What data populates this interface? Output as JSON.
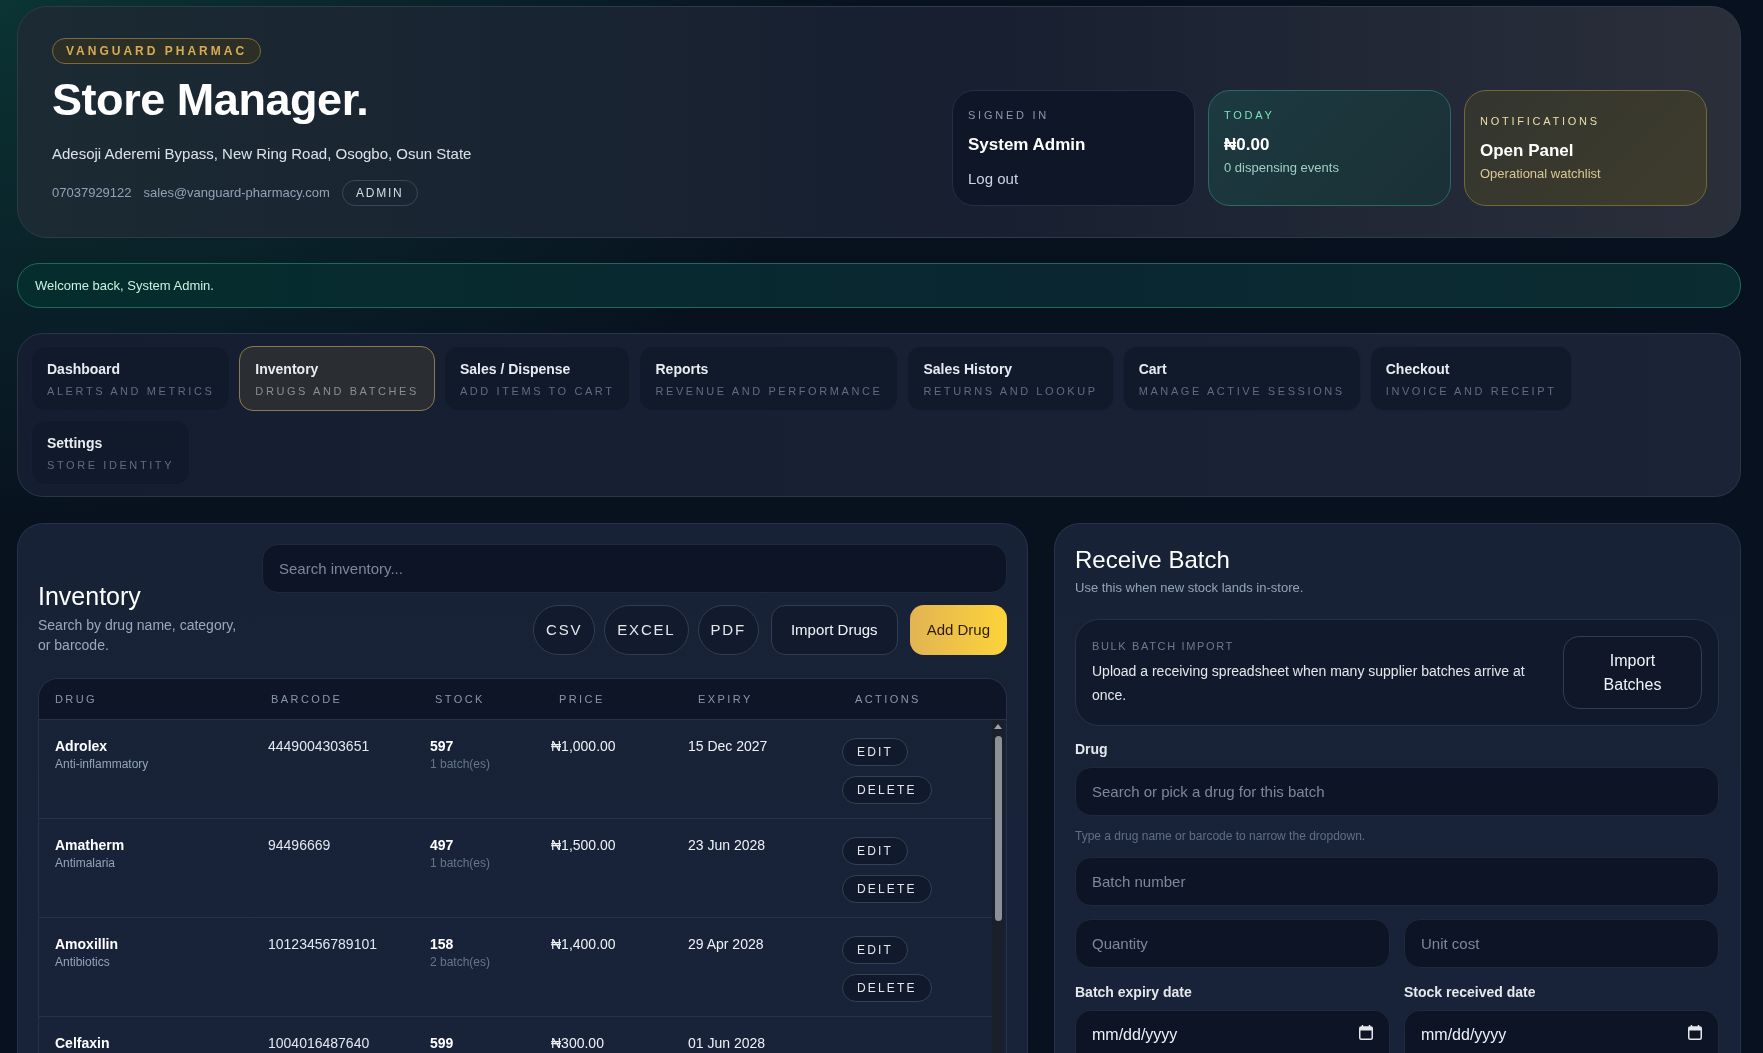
{
  "header": {
    "brand": "VANGUARD PHARMAC",
    "title": "Store Manager.",
    "address": "Adesoji Aderemi Bypass, New Ring Road, Osogbo, Osun State",
    "phone": "07037929122",
    "email": "sales@vanguard-pharmacy.com",
    "role": "ADMIN",
    "cards": [
      {
        "kind": "account",
        "label": "SIGNED IN",
        "title": "System Admin",
        "action": "Log out"
      },
      {
        "kind": "today",
        "label": "TODAY",
        "title": "₦0.00",
        "subtitle": "0 dispensing events"
      },
      {
        "kind": "notifications",
        "label": "NOTIFICATIONS",
        "title": "Open Panel",
        "subtitle": "Operational watchlist"
      }
    ]
  },
  "banner": {
    "message": "Welcome back, System Admin."
  },
  "nav": {
    "tabs": [
      {
        "label": "Dashboard",
        "caption": "ALERTS AND METRICS",
        "selected": false
      },
      {
        "label": "Inventory",
        "caption": "DRUGS AND BATCHES",
        "selected": true
      },
      {
        "label": "Sales / Dispense",
        "caption": "ADD ITEMS TO CART",
        "selected": false
      },
      {
        "label": "Reports",
        "caption": "REVENUE AND PERFORMANCE",
        "selected": false
      },
      {
        "label": "Sales History",
        "caption": "RETURNS AND LOOKUP",
        "selected": false
      },
      {
        "label": "Cart",
        "caption": "MANAGE ACTIVE SESSIONS",
        "selected": false
      },
      {
        "label": "Checkout",
        "caption": "INVOICE AND RECEIPT",
        "selected": false
      },
      {
        "label": "Settings",
        "caption": "STORE IDENTITY",
        "selected": false
      }
    ]
  },
  "inventory": {
    "title": "Inventory",
    "description": "Search by drug name, category, or barcode.",
    "search": {
      "placeholder": "Search inventory..."
    },
    "export_buttons": [
      "CSV",
      "EXCEL",
      "PDF"
    ],
    "import_button": "Import Drugs",
    "add_button": "Add Drug",
    "table": {
      "columns": [
        "DRUG",
        "BARCODE",
        "STOCK",
        "PRICE",
        "EXPIRY",
        "ACTIONS"
      ],
      "rows": [
        {
          "drug": "Adrolex",
          "category": "Anti-inflammatory",
          "barcode": "4449004303651",
          "stock": "597",
          "batches": "1 batch(es)",
          "price": "₦1,000.00",
          "expiry": "15 Dec 2027",
          "actions": [
            "EDIT",
            "DELETE"
          ]
        },
        {
          "drug": "Amatherm",
          "category": "Antimalaria",
          "barcode": "94496669",
          "stock": "497",
          "batches": "1 batch(es)",
          "price": "₦1,500.00",
          "expiry": "23 Jun 2028",
          "actions": [
            "EDIT",
            "DELETE"
          ]
        },
        {
          "drug": "Amoxillin",
          "category": "Antibiotics",
          "barcode": "10123456789101",
          "stock": "158",
          "batches": "2 batch(es)",
          "price": "₦1,400.00",
          "expiry": "29 Apr 2028",
          "actions": [
            "EDIT",
            "DELETE"
          ]
        },
        {
          "drug": "Celfaxin",
          "barcode": "1004016487640",
          "stock": "599",
          "price": "₦300.00",
          "expiry": "01 Jun 2028"
        }
      ]
    }
  },
  "receive_batch": {
    "title": "Receive Batch",
    "subtitle": "Use this when new stock lands in-store.",
    "bulk_import": {
      "label": "BULK BATCH IMPORT",
      "description": "Upload a receiving spreadsheet when many supplier batches arrive at once.",
      "button": "Import Batches"
    },
    "drug": {
      "label": "Drug",
      "placeholder": "Search or pick a drug for this batch",
      "hint": "Type a drug name or barcode to narrow the dropdown."
    },
    "batch_number": {
      "placeholder": "Batch number"
    },
    "quantity": {
      "placeholder": "Quantity"
    },
    "unit_cost": {
      "placeholder": "Unit cost"
    },
    "expiry_date": {
      "label": "Batch expiry date",
      "value": "mm/dd/yyyy"
    },
    "received_date": {
      "label": "Stock received date",
      "value": "mm/dd/yyyy"
    }
  }
}
